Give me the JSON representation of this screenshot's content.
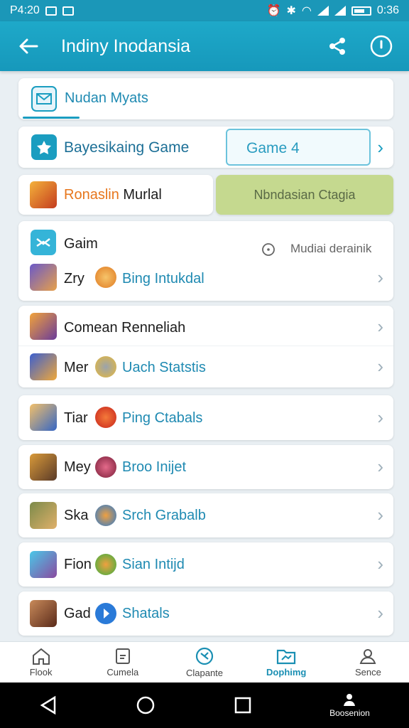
{
  "status": {
    "time_left": "P4:20",
    "time_right": "0:36"
  },
  "appbar": {
    "title": "Indiny Inodansia"
  },
  "header_card": {
    "label": "Nudan Myats"
  },
  "game_row": {
    "label": "Bayesikaing Game",
    "input_value": "Game 4"
  },
  "promo_row": {
    "left_label_orange": "Ronaslin",
    "left_label_black": "Murlal",
    "right_label": "Nbndasian Ctagia"
  },
  "group1": {
    "title": "Gaim",
    "info_text": "Mudiai derainik",
    "item": {
      "name": "Zry",
      "sub": "Bing Intukdal"
    }
  },
  "group2": {
    "title": "Comean Renneliah",
    "item": {
      "name": "Mer",
      "sub": "Uach Statstis"
    }
  },
  "list": [
    {
      "name": "Tiar",
      "sub": "Ping Ctabals"
    },
    {
      "name": "Mey",
      "sub": "Broo Inijet"
    },
    {
      "name": "Ska",
      "sub": "Srch Grabalb"
    },
    {
      "name": "Fion",
      "sub": "Sian Intijd"
    },
    {
      "name": "Gad",
      "sub": "Shatals"
    }
  ],
  "bottom_nav": [
    {
      "label": "Flook",
      "icon": "home-icon"
    },
    {
      "label": "Cumela",
      "icon": "document-icon"
    },
    {
      "label": "Clapante",
      "icon": "clock-icon"
    },
    {
      "label": "Dophimg",
      "icon": "folder-icon"
    },
    {
      "label": "Sence",
      "icon": "person-icon"
    }
  ],
  "sys_nav": {
    "profile_label": "Boosenion"
  },
  "colors": {
    "accent": "#1a9dc0",
    "orange": "#e7761c",
    "promo_green": "#c5d98f"
  }
}
